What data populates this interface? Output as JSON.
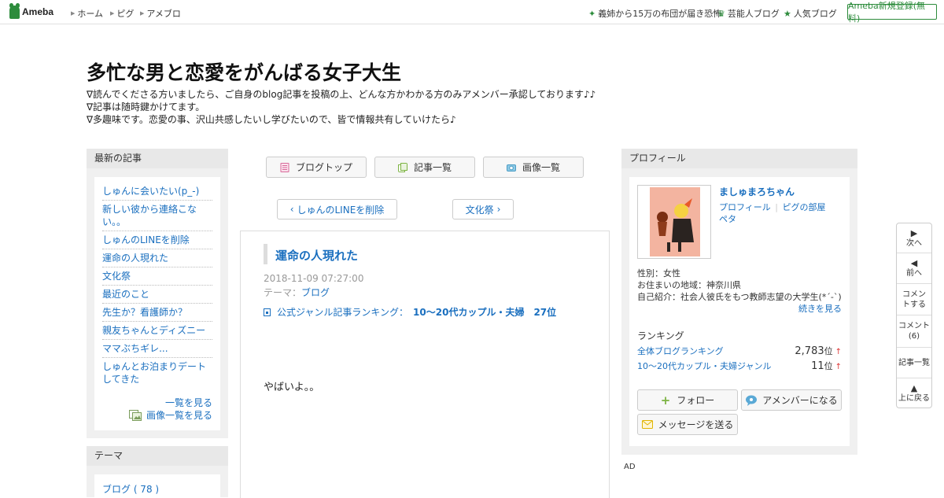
{
  "topbar": {
    "logo": "Ameba",
    "nav": [
      "ホーム",
      "ピグ",
      "アメブロ"
    ],
    "right": [
      {
        "label": "義姉から15万の布団が届き恐怖",
        "icon": "sparkle-icon"
      },
      {
        "label": "芸能人ブログ",
        "icon": "crown-icon"
      },
      {
        "label": "人気ブログ",
        "icon": "star-icon"
      }
    ],
    "signup": "Ameba新規登録(無料)"
  },
  "blog": {
    "title": "多忙な男と恋愛をがんばる女子大生",
    "description": [
      "∇読んでくださる方いましたら、ご自身のblog記事を投稿の上、どんな方かわかる方のみアメンバー承認しております♪♪",
      "∇記事は随時鍵かけてます。",
      "∇多趣味です。恋愛の事、沢山共感したいし学びたいので、皆で情報共有していけたら♪"
    ]
  },
  "latest": {
    "heading": "最新の記事",
    "items": [
      "しゅんに会いたい(p_-)",
      "新しい彼から連絡こない。。",
      "しゅんのLINEを削除",
      "運命の人現れた",
      "文化祭",
      "最近のこと",
      "先生か？看護師か？",
      "親友ちゃんとディズニー",
      "ママぶちギレ...",
      "しゅんとお泊まりデートしてきた"
    ],
    "see_all": "一覧を見る",
    "see_images": "画像一覧を見る"
  },
  "theme": {
    "heading": "テーマ",
    "items": [
      "ブログ ( 78 )"
    ]
  },
  "tabs": {
    "blog_top": "ブログトップ",
    "entries": "記事一覧",
    "images": "画像一覧"
  },
  "pager": {
    "prev": "しゅんのLINEを削除",
    "next": "文化祭"
  },
  "entry": {
    "title": "運命の人現れた",
    "date": "2018-11-09 07:27:00",
    "theme_label": "テーマ：",
    "theme": "ブログ",
    "ranking_label": "公式ジャンル記事ランキング：",
    "ranking_value": "10〜20代カップル・夫婦　27位",
    "body": "やばいよ。。"
  },
  "profile": {
    "heading": "プロフィール",
    "name": "ましゅまろちゃん",
    "links": [
      "プロフィール",
      "ピグの部屋",
      "ペタ"
    ],
    "gender": "性別：女性",
    "location": "お住まいの地域：神奈川県",
    "intro": "自己紹介：社会人彼氏をもつ教師志望の大学生(*´-`)",
    "more": "続きを見る",
    "ranking_heading": "ランキング",
    "rankings": [
      {
        "label": "全体ブログランキング",
        "value": "2,783",
        "unit": "位",
        "arrow": "↑"
      },
      {
        "label": "10〜20代カップル・夫婦ジャンル",
        "value": "11",
        "unit": "位",
        "arrow": "↑"
      }
    ],
    "follow": "フォロー",
    "amember": "アメンバーになる",
    "message": "メッセージを送る"
  },
  "ad": "AD",
  "floatnav": {
    "next": "次へ",
    "prev": "前へ",
    "comment": "コメントする",
    "comments": "コメント",
    "comments_count": "(6)",
    "entries": "記事一覧",
    "top": "上に戻る"
  },
  "colors": {
    "brand": "#2d8c3c",
    "link": "#1a6fbf",
    "rank_up": "#dd3333"
  }
}
